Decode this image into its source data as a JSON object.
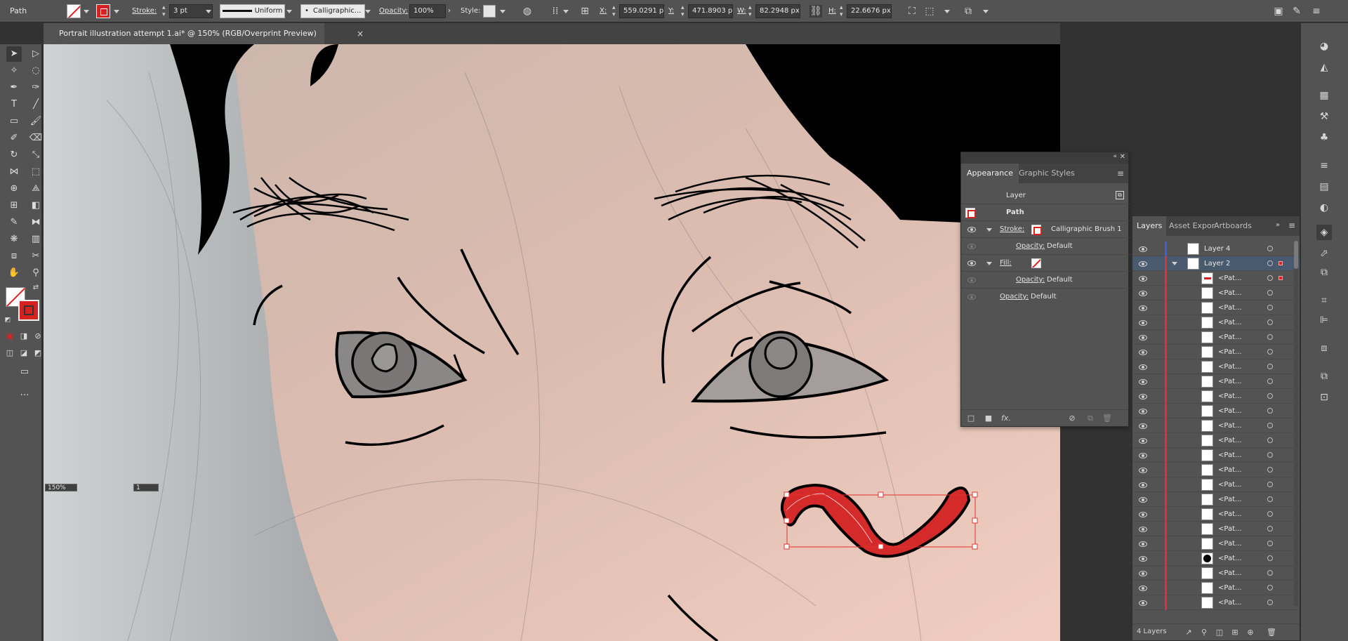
{
  "control_bar": {
    "selection_type": "Path",
    "stroke_label": "Stroke:",
    "stroke_weight": "3 pt",
    "profile": "Uniform",
    "brush": "Calligraphic...",
    "opacity_label": "Opacity:",
    "opacity": "100%",
    "style_label": "Style:",
    "x_label": "X:",
    "x": "559.0291 px",
    "y_label": "Y:",
    "y": "471.8903 px",
    "w_label": "W:",
    "w": "82.2948 px",
    "h_label": "H:",
    "h": "22.6676 px"
  },
  "document_tab": {
    "title": "Portrait illustration attempt 1.ai* @ 150% (RGB/Overprint Preview)",
    "close": "×"
  },
  "canvas": {
    "zoom_field": "150%",
    "artboard_field": "1",
    "selected_path_color": "#d42a2a"
  },
  "appearance_panel": {
    "tabs": [
      "Appearance",
      "Graphic Styles"
    ],
    "layer_row": "Layer",
    "path_row": "Path",
    "stroke_label": "Stroke:",
    "stroke_brush": "Calligraphic Brush 1",
    "opacity_label": "Opacity:",
    "opacity_value": "Default",
    "fill_label": "Fill:",
    "fx": "fx."
  },
  "layers_panel": {
    "tabs": [
      "Layers",
      "Asset Expor",
      "Artboards"
    ],
    "layers": [
      {
        "name": "Layer 4",
        "level": 0,
        "color": "#3f5fe0"
      },
      {
        "name": "Layer 2",
        "level": 0,
        "color": "#e0303a",
        "selected": true
      }
    ],
    "sublayer_name": "<Pat...",
    "sublayer_count": 24,
    "footer": "4 Layers"
  },
  "colors": {
    "accent_red": "#d72020",
    "panel_bg": "#535353",
    "dark_bg": "#323232"
  }
}
